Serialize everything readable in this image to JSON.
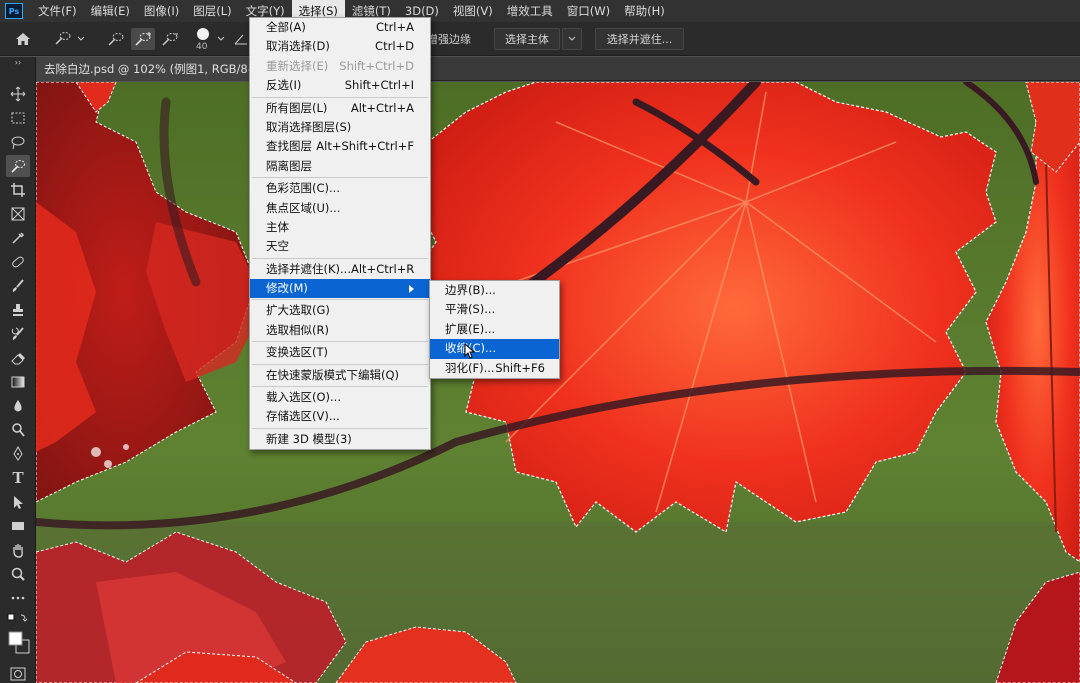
{
  "app": {
    "logo": "Ps"
  },
  "menubar": {
    "items": [
      "文件(F)",
      "编辑(E)",
      "图像(I)",
      "图层(L)",
      "文字(Y)",
      "选择(S)",
      "滤镜(T)",
      "3D(D)",
      "视图(V)",
      "增效工具",
      "窗口(W)",
      "帮助(H)"
    ],
    "active": "选择(S)"
  },
  "options": {
    "brush_size": "40",
    "enhance_edge_label": "增强边缘",
    "select_subject_label": "选择主体",
    "select_mask_label": "选择并遮住..."
  },
  "document": {
    "tab_title": "去除白边.psd @ 102% (例图1, RGB/8#) *"
  },
  "select_menu": {
    "items": [
      {
        "label": "全部(A)",
        "shortcut": "Ctrl+A"
      },
      {
        "label": "取消选择(D)",
        "shortcut": "Ctrl+D"
      },
      {
        "label": "重新选择(E)",
        "shortcut": "Shift+Ctrl+D",
        "disabled": true
      },
      {
        "label": "反选(I)",
        "shortcut": "Shift+Ctrl+I"
      },
      {
        "sep": true
      },
      {
        "label": "所有图层(L)",
        "shortcut": "Alt+Ctrl+A"
      },
      {
        "label": "取消选择图层(S)",
        "shortcut": ""
      },
      {
        "label": "查找图层",
        "shortcut": "Alt+Shift+Ctrl+F"
      },
      {
        "label": "隔离图层",
        "shortcut": ""
      },
      {
        "sep": true
      },
      {
        "label": "色彩范围(C)...",
        "shortcut": ""
      },
      {
        "label": "焦点区域(U)...",
        "shortcut": ""
      },
      {
        "label": "主体",
        "shortcut": ""
      },
      {
        "label": "天空",
        "shortcut": ""
      },
      {
        "sep": true
      },
      {
        "label": "选择并遮住(K)...",
        "shortcut": "Alt+Ctrl+R"
      },
      {
        "label": "修改(M)",
        "shortcut": "",
        "submenu": true,
        "highlight": true
      },
      {
        "sep": true
      },
      {
        "label": "扩大选取(G)",
        "shortcut": ""
      },
      {
        "label": "选取相似(R)",
        "shortcut": ""
      },
      {
        "sep": true
      },
      {
        "label": "变换选区(T)",
        "shortcut": ""
      },
      {
        "sep": true
      },
      {
        "label": "在快速蒙版模式下编辑(Q)",
        "shortcut": ""
      },
      {
        "sep": true
      },
      {
        "label": "载入选区(O)...",
        "shortcut": ""
      },
      {
        "label": "存储选区(V)...",
        "shortcut": ""
      },
      {
        "sep": true
      },
      {
        "label": "新建 3D 模型(3)",
        "shortcut": ""
      }
    ]
  },
  "modify_menu": {
    "items": [
      {
        "label": "边界(B)...",
        "shortcut": ""
      },
      {
        "label": "平滑(S)...",
        "shortcut": ""
      },
      {
        "label": "扩展(E)...",
        "shortcut": ""
      },
      {
        "label": "收缩(C)...",
        "shortcut": "",
        "highlight": true
      },
      {
        "label": "羽化(F)...",
        "shortcut": "Shift+F6"
      }
    ]
  },
  "colors": {
    "accent": "#0a64d2",
    "menubar": "#323232",
    "leaf": "#e8281a",
    "background_green": "#5a7a2e"
  }
}
